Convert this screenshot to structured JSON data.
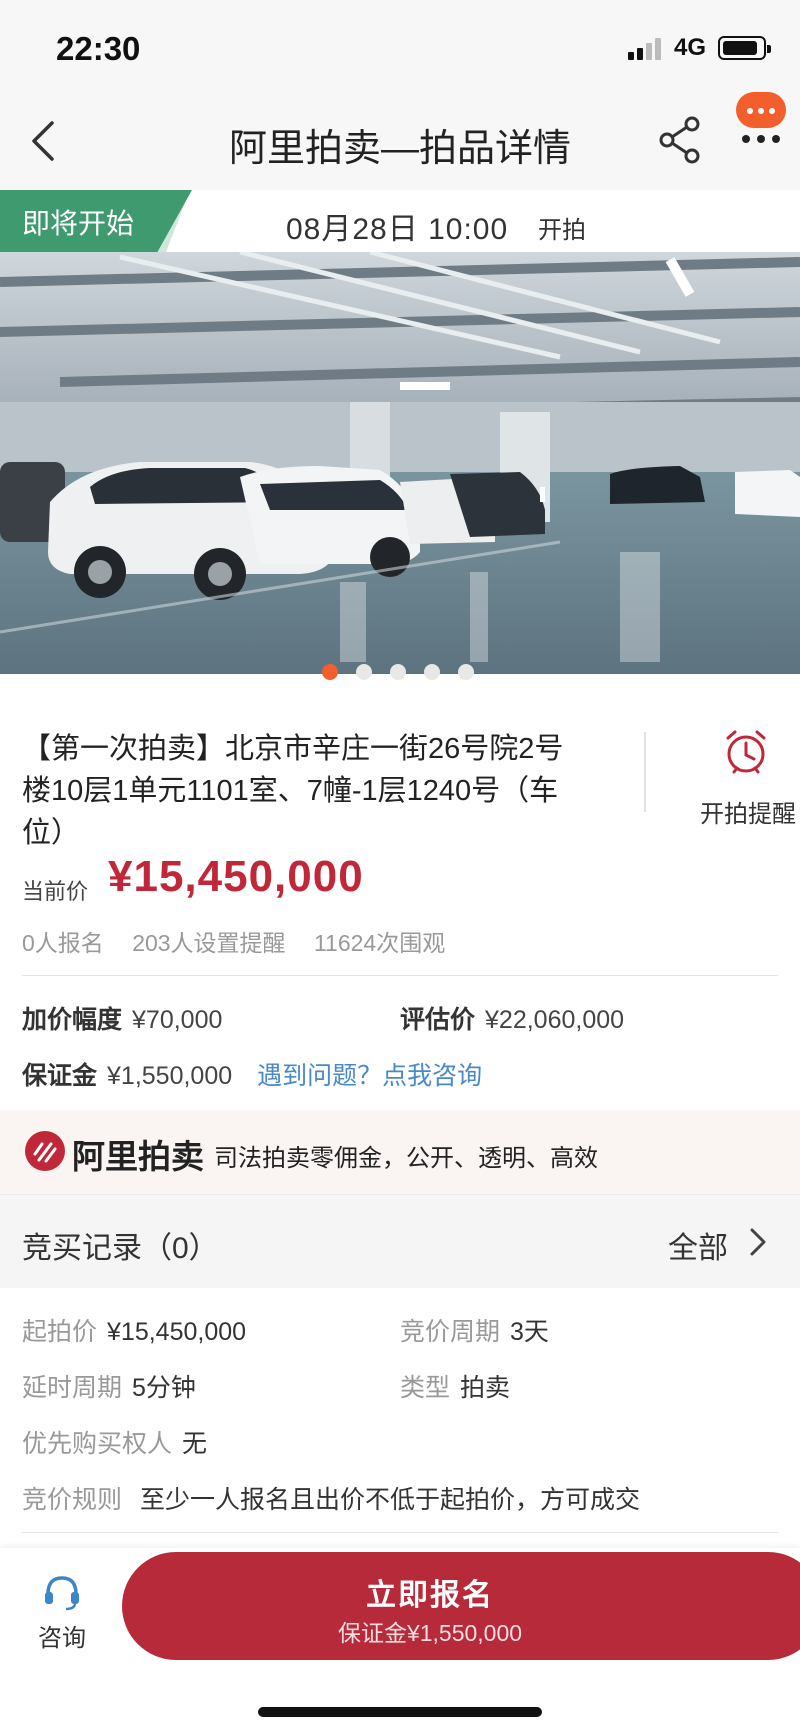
{
  "status_bar": {
    "time": "22:30",
    "network": "4G"
  },
  "nav": {
    "title": "阿里拍卖—拍品详情"
  },
  "auction_status": {
    "tag": "即将开始",
    "start_time": "08月28日 10:00",
    "start_suffix": "开拍"
  },
  "gallery": {
    "image_count": 5,
    "active_index": 0
  },
  "item": {
    "title": "【第一次拍卖】北京市辛庄一街26号院2号楼10层1单元1101室、7幢-1层1240号（车位）",
    "remind_label": "开拍提醒",
    "current_price_label": "当前价",
    "current_price": "¥15,450,000",
    "stats": {
      "signups": "0人报名",
      "reminders": "203人设置提醒",
      "views": "11624次围观"
    }
  },
  "info": {
    "increment_label": "加价幅度",
    "increment_value": "¥70,000",
    "appraisal_label": "评估价",
    "appraisal_value": "¥22,060,000",
    "deposit_label": "保证金",
    "deposit_value": "¥1,550,000",
    "help_link": "遇到问题？点我咨询"
  },
  "banner": {
    "brand": "阿里拍卖",
    "slogan": "司法拍卖零佣金，公开、透明、高效"
  },
  "bid_record": {
    "title": "竞买记录（0）",
    "all_label": "全部"
  },
  "details": {
    "start_price_label": "起拍价",
    "start_price": "¥15,450,000",
    "cycle_label": "竞价周期",
    "cycle": "3天",
    "delay_label": "延时周期",
    "delay": "5分钟",
    "type_label": "类型",
    "type": "拍卖",
    "priority_label": "优先购买权人",
    "priority": "无",
    "rule_label": "竞价规则",
    "rule": "至少一人报名且出价不低于起拍价，方可成交"
  },
  "bottom": {
    "consult_label": "咨询",
    "signup_label": "立即报名",
    "signup_sub": "保证金¥1,550,000"
  },
  "colors": {
    "accent": "#c0283a",
    "button": "#b62a3a",
    "status_green": "#3f9a70",
    "orange": "#f35f2c",
    "link": "#4a89c8"
  }
}
